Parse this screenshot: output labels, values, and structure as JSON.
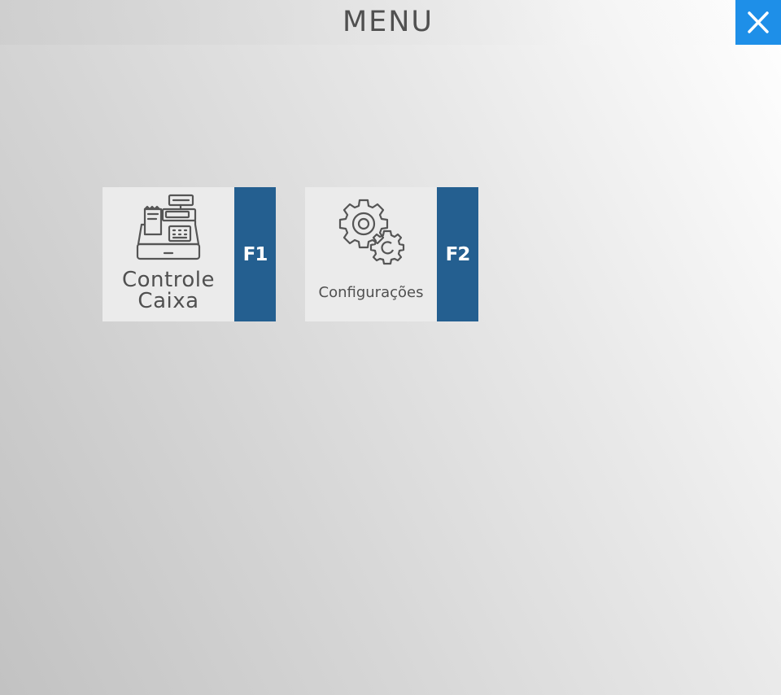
{
  "header": {
    "title": "MENU",
    "close_icon": "close-icon",
    "close_color": "#1e8fe8"
  },
  "tiles": [
    {
      "label_line1": "Controle",
      "label_line2": "Caixa",
      "shortcut": "F1",
      "icon": "cash-register-icon"
    },
    {
      "label": "Configurações",
      "shortcut": "F2",
      "icon": "gears-icon"
    }
  ],
  "colors": {
    "shortcut_bg": "#245f90",
    "tile_bg": "#ebebeb",
    "text": "#505050"
  }
}
